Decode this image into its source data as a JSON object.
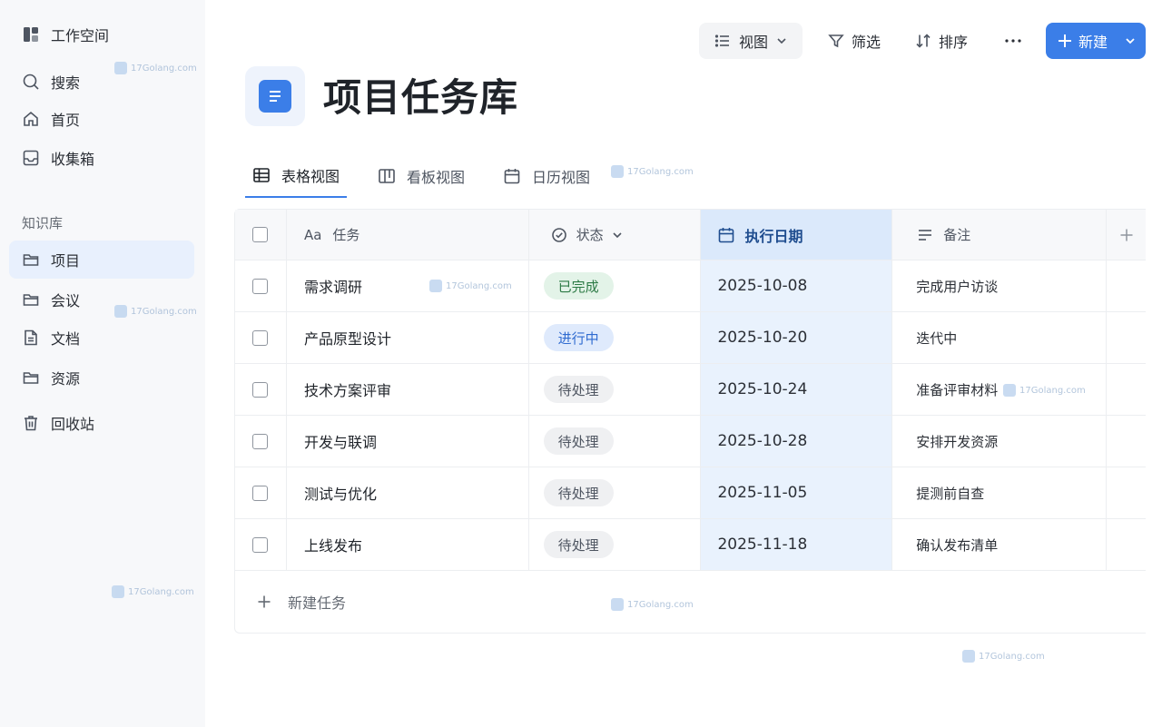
{
  "sidebar": {
    "workspace": "工作空间",
    "search": "搜索",
    "home": "首页",
    "inbox": "收集箱",
    "section": "知识库",
    "items": [
      {
        "label": "项目"
      },
      {
        "label": "会议"
      },
      {
        "label": "文档"
      },
      {
        "label": "资源"
      }
    ],
    "trash": "回收站"
  },
  "toolbar": {
    "view": "视图",
    "filter": "筛选",
    "sort": "排序",
    "new": "新建"
  },
  "page": {
    "title": "项目任务库"
  },
  "tabs": [
    {
      "label": "表格视图",
      "active": true
    },
    {
      "label": "看板视图"
    },
    {
      "label": "日历视图"
    }
  ],
  "table": {
    "columns": {
      "task": "任务",
      "task_prefix": "Aa",
      "status": "状态",
      "date": "执行日期",
      "note": "备注"
    },
    "rows": [
      {
        "task": "需求调研",
        "status": "已完成",
        "date": "2025-10-08",
        "note": "完成用户访谈"
      },
      {
        "task": "产品原型设计",
        "status": "进行中",
        "date": "2025-10-20",
        "note": "迭代中"
      },
      {
        "task": "技术方案评审",
        "status": "待处理",
        "date": "2025-10-24",
        "note": "准备评审材料"
      },
      {
        "task": "开发与联调",
        "status": "待处理",
        "date": "2025-10-28",
        "note": "安排开发资源"
      },
      {
        "task": "测试与优化",
        "status": "待处理",
        "date": "2025-11-05",
        "note": "提测前自查"
      },
      {
        "task": "上线发布",
        "status": "待处理",
        "date": "2025-11-18",
        "note": "确认发布清单"
      }
    ],
    "new_task": "新建任务"
  },
  "watermark": "17Golang.com",
  "colors": {
    "accent": "#3b7ee8",
    "done": "#2c7a45",
    "doing": "#2f6bd0",
    "todo": "#4e5561"
  }
}
